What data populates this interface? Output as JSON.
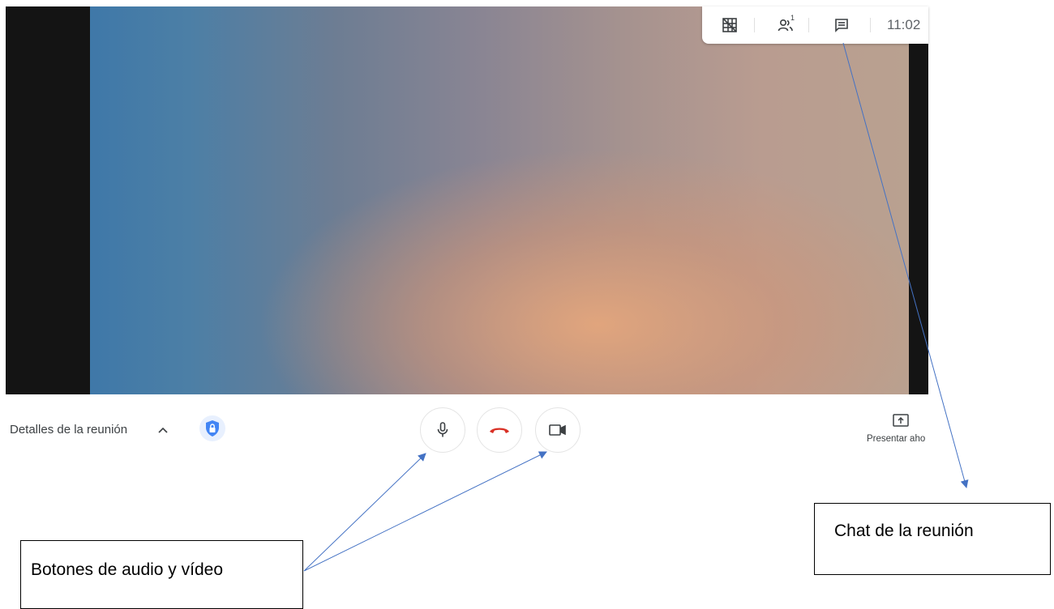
{
  "top_bar": {
    "icons": [
      "grid-layout-icon",
      "participants-icon",
      "chat-icon"
    ],
    "participants_count": "1",
    "clock": "11:02"
  },
  "bottom_bar": {
    "meeting_details_label": "Detalles de la reunión",
    "present_label": "Presentar aho",
    "icons": [
      "chevron-up-icon",
      "security-shield-icon",
      "microphone-icon",
      "hang-up-icon",
      "camera-icon",
      "present-screen-icon"
    ]
  },
  "annotations": {
    "chat_callout": "Chat de la reunión",
    "buttons_callout": "Botones de audio y vídeo"
  },
  "colors": {
    "hangup_red": "#d93025",
    "shield_blue": "#4285f4",
    "annotation_line": "#4472c4"
  }
}
